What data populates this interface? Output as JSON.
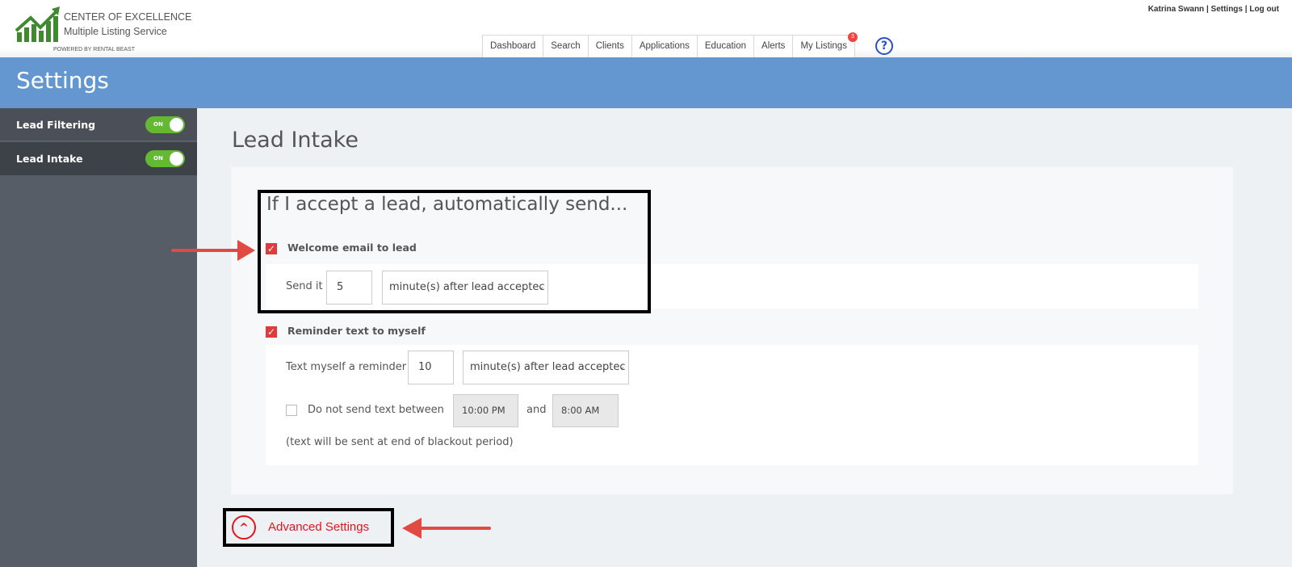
{
  "header": {
    "logo": {
      "line1": "CENTER OF  EXCELLENCE",
      "line2": "Multiple Listing  Service",
      "line3": "POWERED BY RENTAL BEAST",
      "icon": "growth-chart-logo"
    },
    "user_links": [
      "Katrina Swann",
      "Settings",
      "Log out"
    ],
    "nav": [
      {
        "label": "Dashboard"
      },
      {
        "label": "Search"
      },
      {
        "label": "Clients"
      },
      {
        "label": "Applications"
      },
      {
        "label": "Education"
      },
      {
        "label": "Alerts"
      },
      {
        "label": "My Listings",
        "badge": "3"
      }
    ],
    "help_icon": "?"
  },
  "page_title": "Settings",
  "sidebar": {
    "items": [
      {
        "label": "Lead Filtering",
        "toggle": "ON",
        "on": true
      },
      {
        "label": "Lead Intake",
        "toggle": "ON",
        "on": true,
        "selected": true
      }
    ]
  },
  "main": {
    "title": "Lead Intake",
    "section_heading": "If I accept a lead, automatically send...",
    "welcome": {
      "label": "Welcome email to lead",
      "checked": true,
      "send_label": "Send it",
      "value": "5",
      "unit": "minute(s) after lead acceptec"
    },
    "reminder": {
      "label": "Reminder text to myself",
      "checked": true,
      "text_label": "Text myself a reminder",
      "value": "10",
      "unit": "minute(s) after lead acceptec",
      "blackout_label": "Do not send text between",
      "blackout_checked": false,
      "start": "10:00 PM",
      "and": "and",
      "end": "8:00 AM",
      "note": "(text will be sent at end of blackout period)"
    },
    "advanced": "Advanced Settings"
  },
  "colors": {
    "accent_band": "#6497cf",
    "toggle_on": "#64b933",
    "checkbox": "#e23a3a",
    "advanced": "#e0161e",
    "annotation_arrow": "#e04a42"
  }
}
